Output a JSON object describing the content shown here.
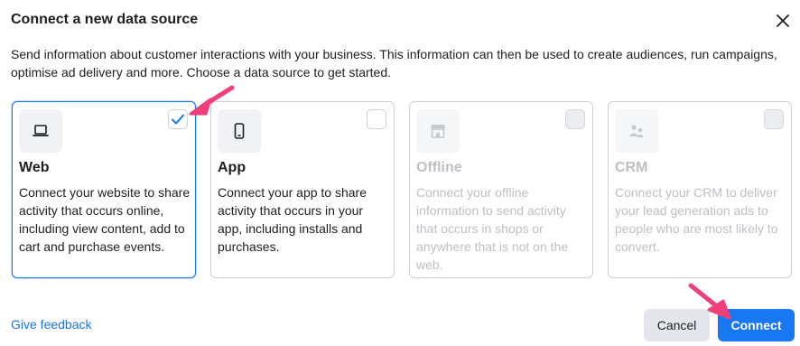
{
  "dialog": {
    "title": "Connect a new data source",
    "description": "Send information about customer interactions with your business. This information can then be used to create audiences, run campaigns, optimise ad delivery and more. Choose a data source to get started."
  },
  "sources": [
    {
      "name": "Web",
      "description": "Connect your website to share activity that occurs online, including view content, add to cart and purchase events.",
      "icon": "laptop-icon",
      "selected": true,
      "enabled": true
    },
    {
      "name": "App",
      "description": "Connect your app to share activity that occurs in your app, including installs and purchases.",
      "icon": "mobile-phone-icon",
      "selected": false,
      "enabled": true
    },
    {
      "name": "Offline",
      "description": "Connect your offline information to send activity that occurs in shops or anywhere that is not on the web.",
      "icon": "store-icon",
      "selected": false,
      "enabled": false
    },
    {
      "name": "CRM",
      "description": "Connect your CRM to deliver your lead generation ads to people who are most likely to convert.",
      "icon": "people-icon",
      "selected": false,
      "enabled": false
    }
  ],
  "footer": {
    "feedback_label": "Give feedback",
    "cancel_label": "Cancel",
    "connect_label": "Connect"
  },
  "colors": {
    "accent": "#1877f2",
    "annotation_arrow": "#f0407a"
  }
}
